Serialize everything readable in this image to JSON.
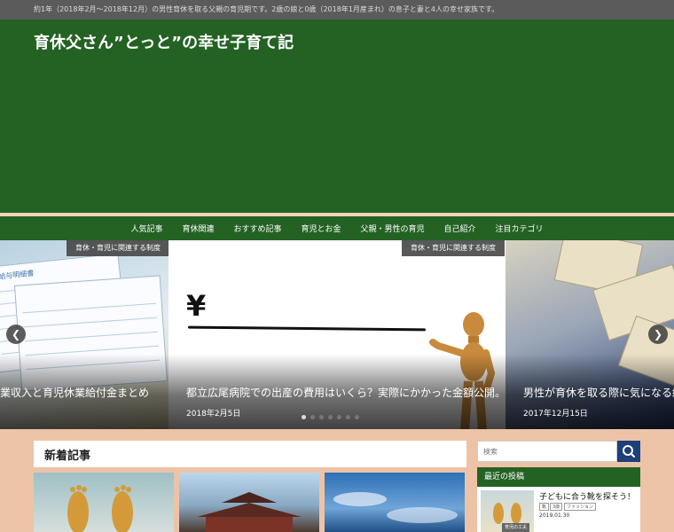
{
  "topbar": {
    "text": "約1年（2018年2月～2018年12月）の男性育休を取る父親の育児期です。2歳の娘と0歳（2018年1月産まれ）の息子と妻と4人の幸せ家族です。"
  },
  "header": {
    "title": "育休父さん”とっと”の幸せ子育て記"
  },
  "nav": {
    "items": [
      {
        "label": "人気記事"
      },
      {
        "label": "育休関連"
      },
      {
        "label": "おすすめ記事"
      },
      {
        "label": "育児とお金"
      },
      {
        "label": "父親・男性の育児"
      },
      {
        "label": "自己紹介"
      },
      {
        "label": "注目カテゴリ"
      }
    ]
  },
  "slider": {
    "left": {
      "category": "育休・育児に関連する制度",
      "title": "業収入と育児休業給付金まとめ",
      "paper_header": "給与明細書"
    },
    "center": {
      "category": "育休・育児に関連する制度",
      "title": "都立広尾病院での出産の費用はいくら？実際にかかった金額公開。",
      "date": "2018年2月5日",
      "yen": "¥"
    },
    "right": {
      "title": "男性が育休を取る際に気になる給与",
      "date": "2017年12月15日"
    },
    "prev": "❮",
    "next": "❯",
    "active_dot": 0
  },
  "main": {
    "section_title": "新着記事"
  },
  "sidebar": {
    "search_placeholder": "検索",
    "widget_title": "最近の投稿",
    "recent": {
      "title": "子どもに合う靴を探そう！",
      "tags": [
        "靴",
        "3歳",
        "ファッション"
      ],
      "date": "2019.01.30",
      "thumb_caption": "育児の工夫"
    }
  },
  "colors": {
    "accent": "#246224",
    "background": "#ecc3a7",
    "search_button": "#1d3f7a"
  }
}
